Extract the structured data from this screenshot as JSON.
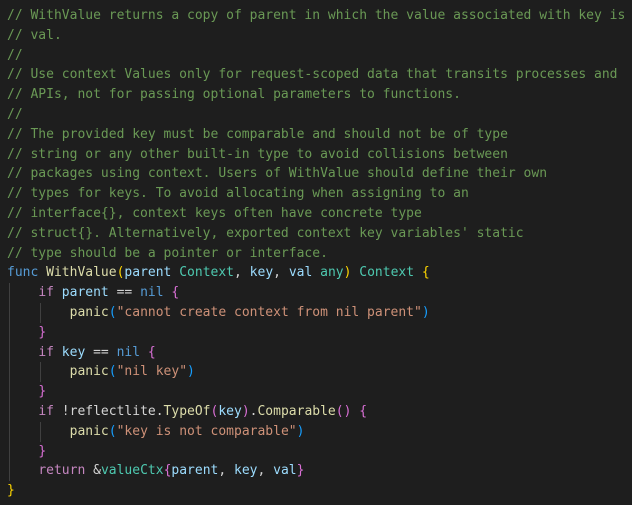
{
  "comment_lines": [
    "// WithValue returns a copy of parent in which the value associated with key is",
    "// val.",
    "//",
    "// Use context Values only for request-scoped data that transits processes and",
    "// APIs, not for passing optional parameters to functions.",
    "//",
    "// The provided key must be comparable and should not be of type",
    "// string or any other built-in type to avoid collisions between",
    "// packages using context. Users of WithValue should define their own",
    "// types for keys. To avoid allocating when assigning to an",
    "// interface{}, context keys often have concrete type",
    "// struct{}. Alternatively, exported context key variables' static",
    "// type should be a pointer or interface."
  ],
  "code": {
    "func_kw": "func",
    "func_name": "WithValue",
    "params": {
      "open": "(",
      "p1": "parent",
      "t1": "Context",
      "comma1": ", ",
      "p2": "key",
      "comma2": ", ",
      "p3": "val",
      "t3": "any",
      "close": ")"
    },
    "return_type": "Context",
    "brace_open": "{",
    "brace_close": "}",
    "if_kw": "if",
    "return_kw": "return",
    "nil_kw": "nil",
    "eq_op": "==",
    "panic_fn": "panic",
    "if1": {
      "var": "parent",
      "msg": "\"cannot create context from nil parent\""
    },
    "if2": {
      "var": "key",
      "msg": "\"nil key\""
    },
    "if3": {
      "not": "!",
      "pkg": "reflectlite",
      "dot1": ".",
      "fn": "TypeOf",
      "arg": "key",
      "dot2": ".",
      "method": "Comparable",
      "call": "()",
      "msg": "\"key is not comparable\""
    },
    "ret": {
      "amp": "&",
      "type": "valueCtx",
      "open": "{",
      "a1": "parent",
      "sep1": ", ",
      "a2": "key",
      "sep2": ", ",
      "a3": "val",
      "close": "}"
    }
  },
  "colors": {
    "background": "#1e1e1e",
    "comment": "#6a9955",
    "keyword": "#569cd6",
    "control": "#c586c0",
    "function": "#dcdcaa",
    "type": "#4ec9b0",
    "variable": "#9cdcfe",
    "string": "#ce9178",
    "bracket_gold": "#ffd700",
    "bracket_orchid": "#da70d6",
    "bracket_blue": "#179fff"
  }
}
